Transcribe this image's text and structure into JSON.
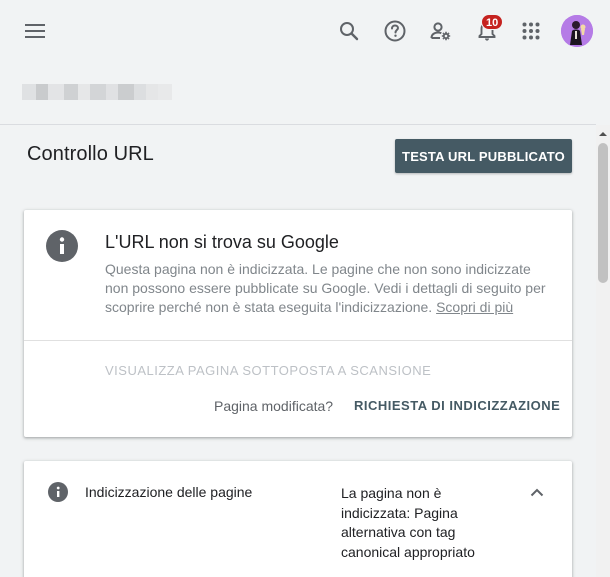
{
  "header": {
    "menu_icon": "hamburger-menu-icon",
    "search_icon": "search-icon",
    "help_icon": "help-circle-icon",
    "users_icon": "manage-users-icon",
    "notifications_icon": "bell-icon",
    "notifications_count": "10",
    "apps_icon": "apps-grid-icon",
    "avatar_icon": "user-avatar"
  },
  "property_selector": {
    "value": "",
    "blurred": true
  },
  "page": {
    "title": "Controllo URL",
    "test_button_label": "TESTA URL PUBBLICATO"
  },
  "status_card": {
    "icon": "info-icon",
    "title": "L'URL non si trova su Google",
    "description": "Questa pagina non è indicizzata. Le pagine che non sono indicizzate non possono essere pubblicate su Google. Vedi i dettagli di seguito per scoprire perché non è stata eseguita l'indicizzazione.",
    "learn_more": "Scopri di più",
    "view_crawled_label": "VISUALIZZA PAGINA SOTTOPOSTA A SCANSIONE",
    "page_changed_question": "Pagina modificata?",
    "request_indexing_label": "RICHIESTA DI INDICIZZAZIONE"
  },
  "indexing_card": {
    "icon": "info-icon",
    "label": "Indicizzazione delle pagine",
    "value": "La pagina non è indicizzata: Pagina alternativa con tag canonical appropriato",
    "expand_icon": "chevron-up-icon"
  },
  "colors": {
    "primary_button": "#455a64",
    "background": "#f1f3f4",
    "badge": "#c5221f",
    "avatar": "#b57be6",
    "icon_grey": "#5f6368"
  }
}
